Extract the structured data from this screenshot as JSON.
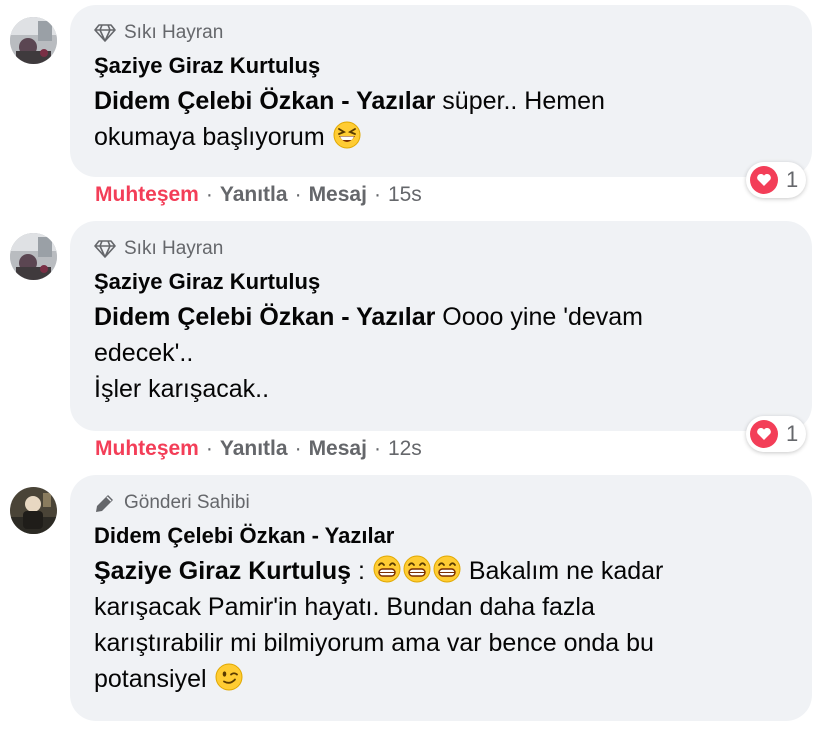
{
  "comments": [
    {
      "badge": "Sıkı Hayran",
      "author": "Şaziye Giraz Kurtuluş",
      "mention": "Didem Çelebi Özkan - Yazılar",
      "text_1": " süper.. Hemen",
      "text_2": "okumaya başlıyorum ",
      "emoji_icon": "grinning-squinting-face-icon",
      "reaction_action": "Muhteşem",
      "reply_action": "Yanıtla",
      "message_action": "Mesaj",
      "time": "15s",
      "reaction_count": "1",
      "reaction_icon": "heart-icon"
    },
    {
      "badge": "Sıkı Hayran",
      "author": "Şaziye Giraz Kurtuluş",
      "mention": "Didem Çelebi Özkan - Yazılar",
      "text_1": " Oooo yine 'devam",
      "text_2": "edecek'..",
      "text_3": "İşler karışacak..",
      "reaction_action": "Muhteşem",
      "reply_action": "Yanıtla",
      "message_action": "Mesaj",
      "time": "12s",
      "reaction_count": "1",
      "reaction_icon": "heart-icon"
    },
    {
      "badge": "Gönderi Sahibi",
      "author": "Didem Çelebi Özkan - Yazılar",
      "mention": "Şaziye Giraz Kurtuluş",
      "text_1": " : ",
      "text_1b": " Bakalım ne kadar",
      "text_2": "karışacak Pamir'in hayatı. Bundan daha fazla",
      "text_3": "karıştırabilir mi bilmiyorum ama var bence onda bu",
      "text_4": "potansiyel ",
      "emoji_icons": [
        "beaming-face-icon",
        "beaming-face-icon",
        "beaming-face-icon",
        "winking-face-icon"
      ]
    }
  ],
  "colors": {
    "bubble": "#f0f2f5",
    "secondary_text": "#65676b",
    "reaction_accent": "#f33e58"
  }
}
